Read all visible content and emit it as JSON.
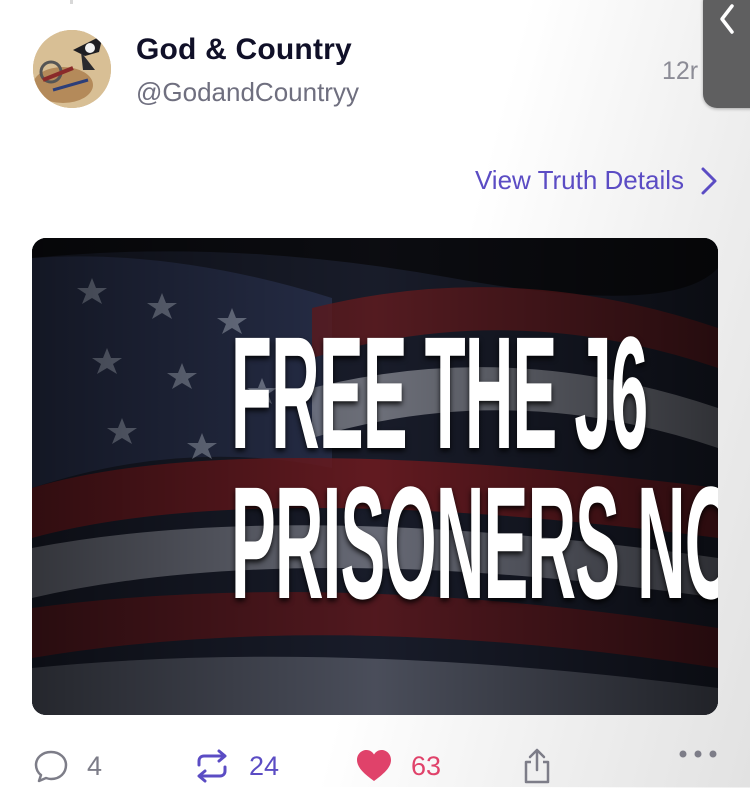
{
  "post": {
    "display_name": "God & Country",
    "handle": "@GodandCountryy",
    "timestamp": "12r",
    "details_link": "View Truth Details",
    "image_text": [
      "FREE THE J6",
      "PRISONERS NOW!"
    ]
  },
  "actions": {
    "replies": "4",
    "retruths": "24",
    "likes": "63"
  },
  "icons": {
    "reply": "speech-bubble-icon",
    "retruth": "repost-arrows-icon",
    "like": "heart-icon",
    "share": "share-icon",
    "more": "more-dots-icon",
    "details": "chevron-right-icon",
    "side_tab": "chevron-left-icon"
  },
  "colors": {
    "accent": "#5b4cc4",
    "like": "#e0426a",
    "muted": "#7d7d88"
  }
}
